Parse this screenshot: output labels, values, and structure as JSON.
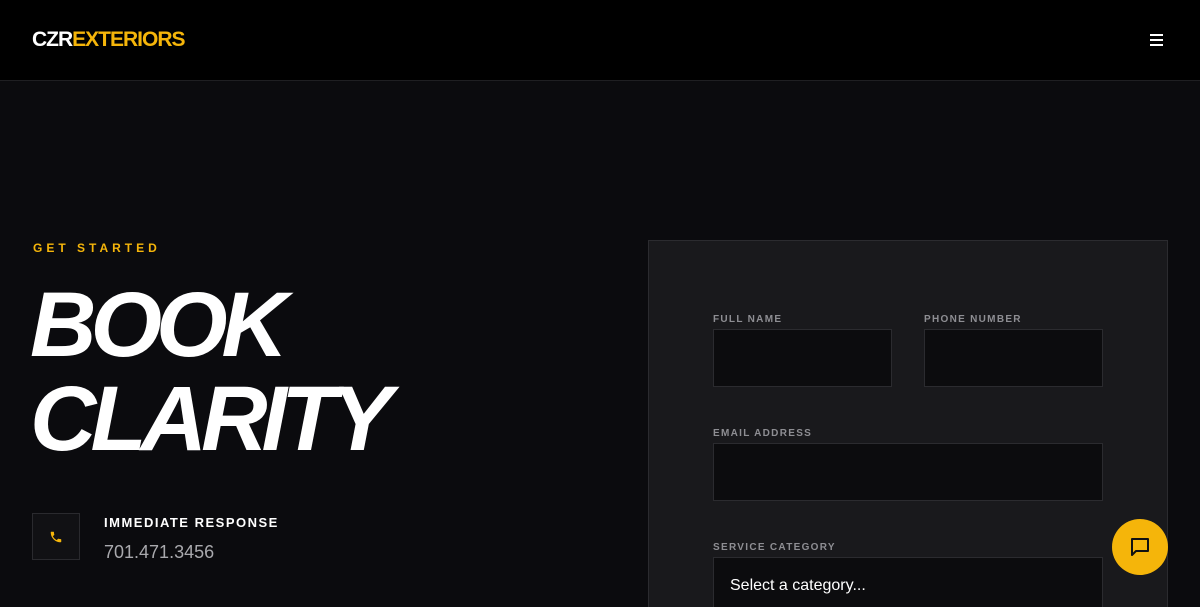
{
  "header": {
    "logo_part1": "CZR",
    "logo_part2": "EXTERIORS"
  },
  "hero": {
    "eyebrow": "GET STARTED",
    "title_line1": "BOOK",
    "title_line2": "CLARITY"
  },
  "contact": {
    "label": "IMMEDIATE RESPONSE",
    "phone": "701.471.3456"
  },
  "form": {
    "full_name_label": "FULL NAME",
    "phone_label": "PHONE NUMBER",
    "email_label": "EMAIL ADDRESS",
    "service_label": "SERVICE CATEGORY",
    "service_selected": "Select a category..."
  },
  "colors": {
    "accent": "#f5b50a",
    "background": "#0b0b0e",
    "panel": "#19191c"
  },
  "icons": {
    "menu": "hamburger-menu-icon",
    "phone": "phone-icon",
    "chat": "chat-bubble-icon"
  }
}
